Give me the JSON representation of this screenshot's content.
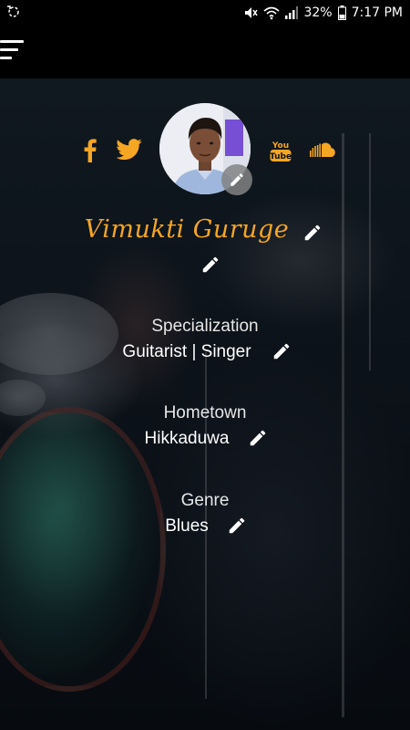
{
  "status_bar": {
    "battery": "32%",
    "time": "7:17 PM",
    "icons": [
      "sync-icon",
      "mute-icon",
      "wifi-icon",
      "signal-icon",
      "battery-icon"
    ]
  },
  "app_bar": {
    "menu_icon": "hamburger-menu-icon"
  },
  "social_links": [
    "facebook-icon",
    "twitter-icon",
    "youtube-icon",
    "soundcloud-icon"
  ],
  "profile": {
    "name": "Vimukti Guruge"
  },
  "fields": [
    {
      "label": "Specialization",
      "value": "Guitarist | Singer"
    },
    {
      "label": "Hometown",
      "value": "Hikkaduwa"
    },
    {
      "label": "Genre",
      "value": "Blues"
    }
  ],
  "colors": {
    "accent": "#f5a623",
    "background": "#000000",
    "text": "#ffffff"
  }
}
